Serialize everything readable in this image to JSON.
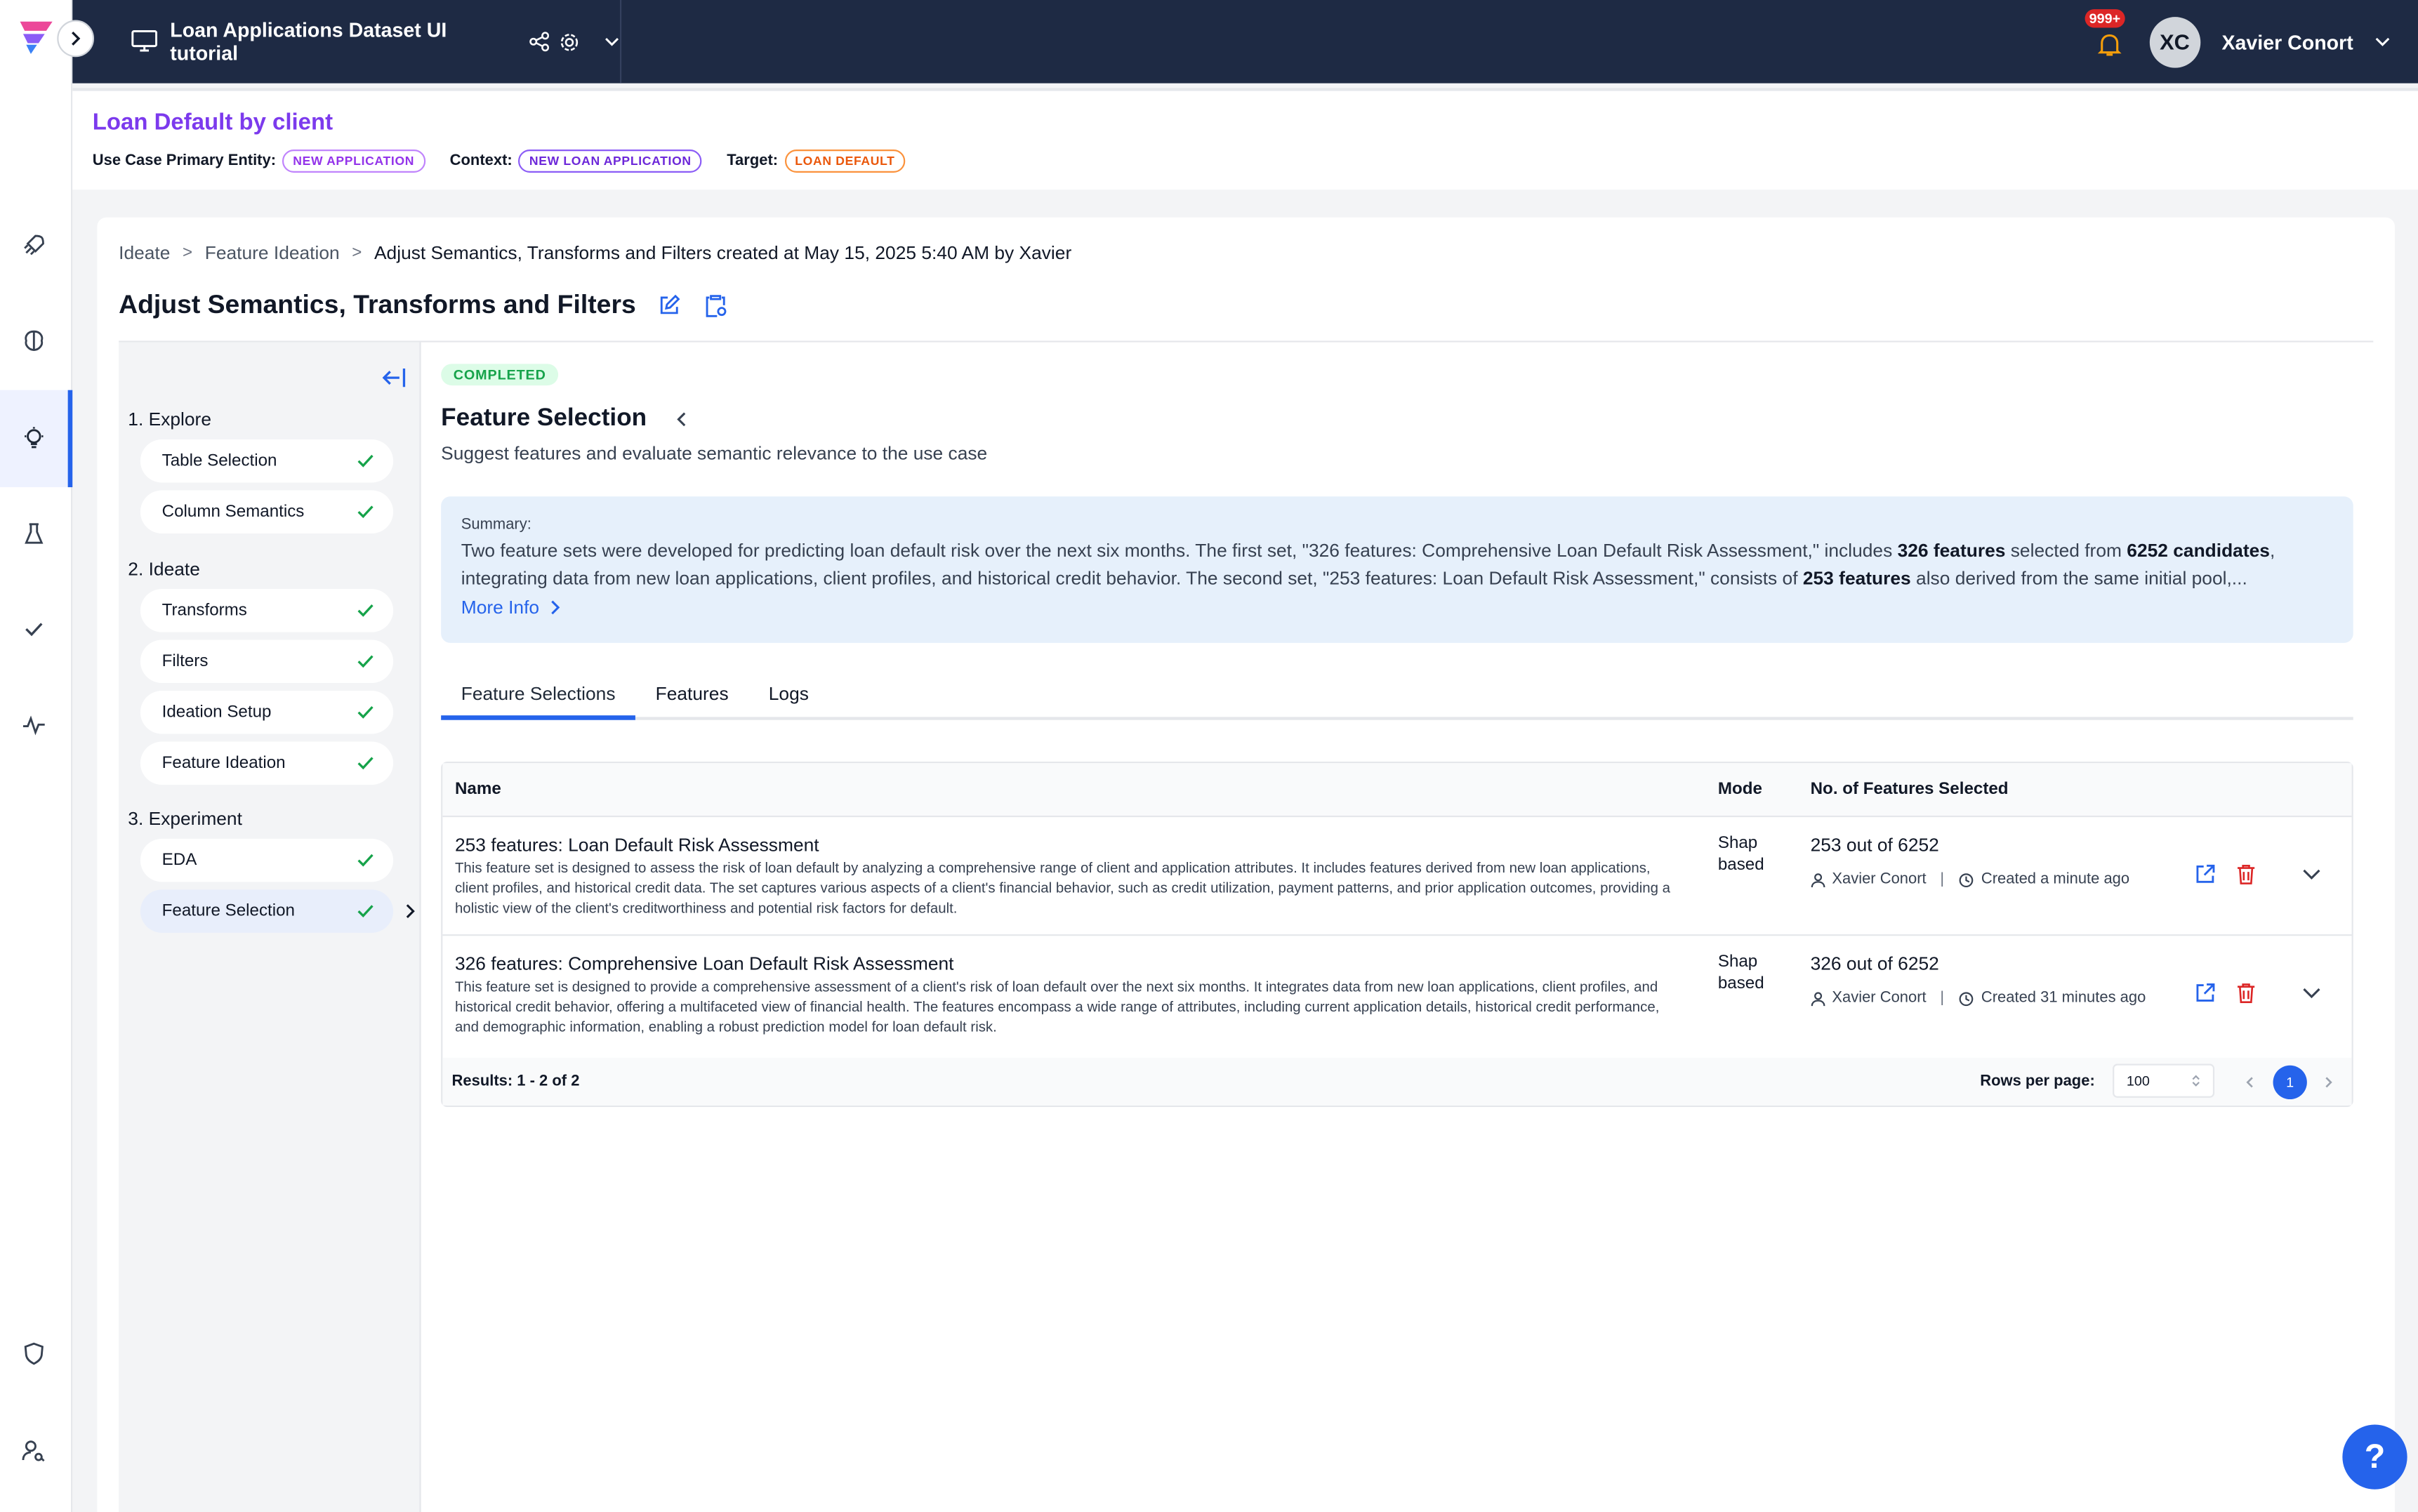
{
  "app": {
    "project_title": "Loan Applications Dataset UI tutorial",
    "notifications_badge": "999+",
    "user_initials": "XC",
    "user_name": "Xavier Conort"
  },
  "rail_icons": [
    "rocket-icon",
    "brain-icon",
    "lightbulb-icon",
    "flask-icon",
    "checkmark-icon",
    "activity-icon",
    "shield-icon",
    "user-search-icon"
  ],
  "use_case": {
    "title": "Loan Default by client",
    "primary_entity_label": "Use Case Primary Entity:",
    "primary_entity": "NEW APPLICATION",
    "context_label": "Context:",
    "context": "NEW LOAN APPLICATION",
    "target_label": "Target:",
    "target": "LOAN DEFAULT"
  },
  "breadcrumb": {
    "items": [
      "Ideate",
      "Feature Ideation",
      "Adjust Semantics, Transforms and Filters created at May 15, 2025 5:40 AM by Xavier"
    ],
    "separator": ">"
  },
  "page": {
    "title": "Adjust Semantics, Transforms and Filters"
  },
  "steps": {
    "sections": [
      {
        "label": "1. Explore",
        "items": [
          "Table Selection",
          "Column Semantics"
        ]
      },
      {
        "label": "2. Ideate",
        "items": [
          "Transforms",
          "Filters",
          "Ideation Setup",
          "Feature Ideation"
        ]
      },
      {
        "label": "3. Experiment",
        "items": [
          "EDA",
          "Feature Selection"
        ]
      }
    ],
    "active": "Feature Selection"
  },
  "content": {
    "status": "COMPLETED",
    "title": "Feature Selection",
    "subtitle": "Suggest features and evaluate semantic relevance to the use case",
    "summary_label": "Summary:",
    "summary_p1": "Two feature sets were developed for predicting loan default risk over the next six months. The first set, \"326 features: Comprehensive Loan Default Risk Assessment,\" includes ",
    "summary_b1": "326 features",
    "summary_p2": " selected from ",
    "summary_b2": "6252 candidates",
    "summary_p3": ", integrating data from new loan applications, client profiles, and historical credit behavior. The second set, \"253 features: Loan Default Risk Assessment,\" consists of ",
    "summary_b3": "253 features",
    "summary_p4": " also derived from the same initial pool,...",
    "more_info": "More Info",
    "tabs": [
      "Feature Selections",
      "Features",
      "Logs"
    ],
    "active_tab": "Feature Selections"
  },
  "table": {
    "columns": [
      "Name",
      "Mode",
      "No. of Features Selected"
    ],
    "rows": [
      {
        "name": "253 features: Loan Default Risk Assessment",
        "description": "This feature set is designed to assess the risk of loan default by analyzing a comprehensive range of client and application attributes. It includes features derived from new loan applications, client profiles, and historical credit data. The set captures various aspects of a client's financial behavior, such as credit utilization, payment patterns, and prior application outcomes, providing a holistic view of the client's creditworthiness and potential risk factors for default.",
        "mode": "Shap based",
        "count": "253 out of 6252",
        "author": "Xavier Conort",
        "created": "Created a minute ago"
      },
      {
        "name": "326 features: Comprehensive Loan Default Risk Assessment",
        "description": "This feature set is designed to provide a comprehensive assessment of a client's risk of loan default over the next six months. It integrates data from new loan applications, client profiles, and historical credit behavior, offering a multifaceted view of financial health. The features encompass a wide range of attributes, including current application details, historical credit performance, and demographic information, enabling a robust prediction model for loan default risk.",
        "mode": "Shap based",
        "count": "326 out of 6252",
        "author": "Xavier Conort",
        "created": "Created 31 minutes ago"
      }
    ],
    "results": "Results: 1 - 2 of 2",
    "rows_per_page_label": "Rows per page:",
    "rows_per_page": "100",
    "current_page": "1"
  },
  "help_label": "?"
}
